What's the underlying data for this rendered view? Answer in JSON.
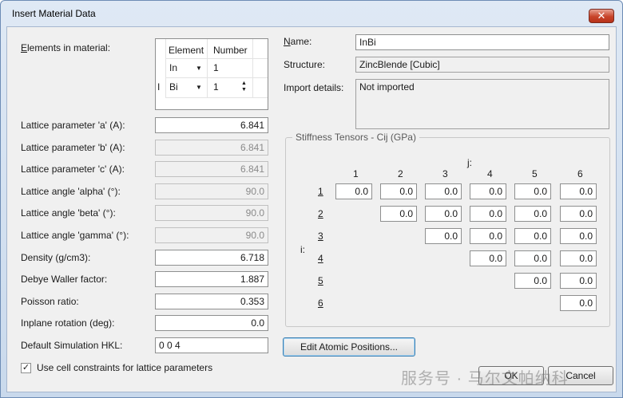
{
  "window": {
    "title": "Insert Material Data",
    "close_glyph": "✕"
  },
  "elements": {
    "label": "Elements in material:",
    "headers": [
      "Element",
      "Number"
    ],
    "rows": [
      {
        "marker": "",
        "element": "In",
        "number": "1"
      },
      {
        "marker": "I",
        "element": "Bi",
        "number": "1"
      }
    ]
  },
  "material": {
    "name_label": "Name:",
    "name": "InBi",
    "structure_label": "Structure:",
    "structure": "ZincBlende [Cubic]",
    "import_label": "Import details:",
    "import_details": "Not imported"
  },
  "params": [
    {
      "label": "Lattice parameter 'a' (A):",
      "value": "6.841",
      "enabled": true
    },
    {
      "label": "Lattice parameter 'b' (A):",
      "value": "6.841",
      "enabled": false
    },
    {
      "label": "Lattice parameter 'c' (A):",
      "value": "6.841",
      "enabled": false
    },
    {
      "label": "Lattice angle 'alpha' (°):",
      "value": "90.0",
      "enabled": false
    },
    {
      "label": "Lattice angle 'beta' (°):",
      "value": "90.0",
      "enabled": false
    },
    {
      "label": "Lattice angle 'gamma' (°):",
      "value": "90.0",
      "enabled": false
    },
    {
      "label": "Density (g/cm3):",
      "value": "6.718",
      "enabled": true
    },
    {
      "label": "Debye Waller factor:",
      "value": "1.887",
      "enabled": true
    },
    {
      "label": "Poisson ratio:",
      "value": "0.353",
      "enabled": true
    },
    {
      "label": "Inplane rotation (deg):",
      "value": "0.0",
      "enabled": true
    },
    {
      "label": "Default Simulation HKL:",
      "value": "0 0 4",
      "enabled": true
    }
  ],
  "stiffness": {
    "title": "Stiffness Tensors - Cij (GPa)",
    "j_label": "j:",
    "i_label": "i:",
    "cols": [
      "1",
      "2",
      "3",
      "4",
      "5",
      "6"
    ],
    "rows": [
      "1",
      "2",
      "3",
      "4",
      "5",
      "6"
    ],
    "cell_value": "0.0"
  },
  "buttons": {
    "atomic_positions": "Edit Atomic Positions...",
    "ok": "OK",
    "cancel": "Cancel"
  },
  "constraints": {
    "label": "Use cell constraints for lattice parameters",
    "checked": true,
    "check_glyph": "✓"
  },
  "watermark": "服务号 · 马尔文帕纳科"
}
